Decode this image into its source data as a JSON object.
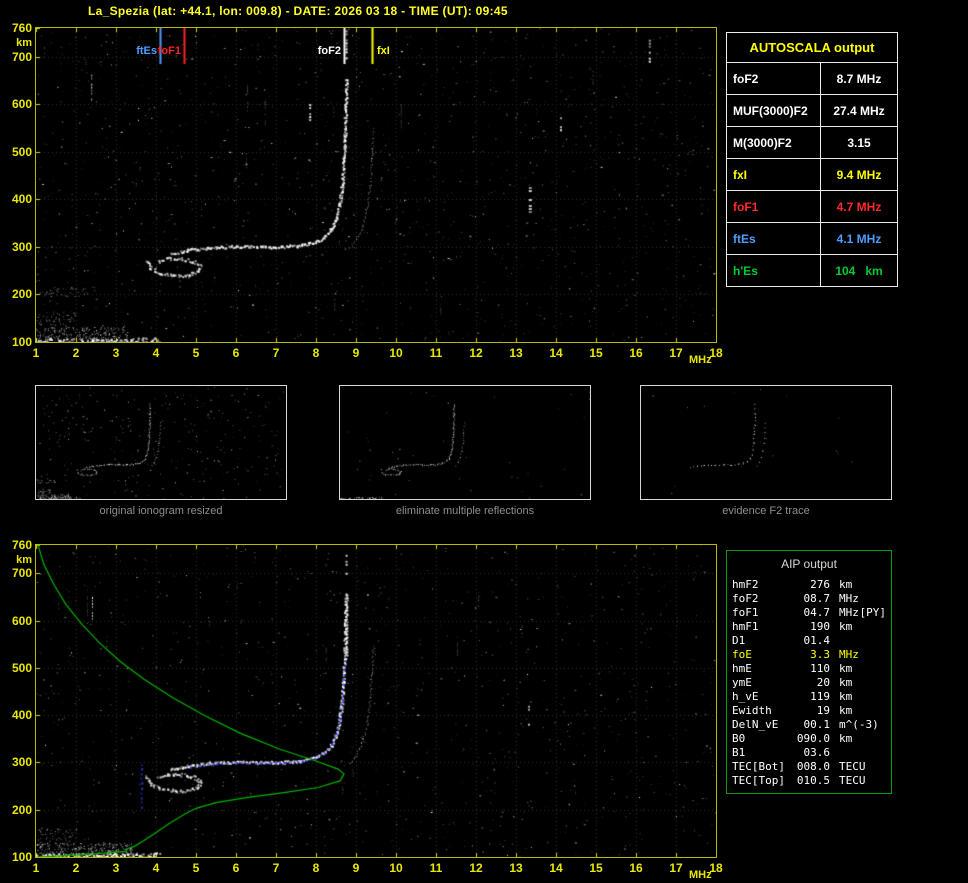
{
  "header": {
    "title": "La_Spezia (lat: +44.1, lon: 009.8) - DATE: 2026 03 18 - TIME (UT): 09:45"
  },
  "autoscala": {
    "title": "AUTOSCALA output",
    "rows": [
      {
        "label": "foF2",
        "value": "8.7 MHz",
        "color": "#ffffff"
      },
      {
        "label": "MUF(3000)F2",
        "value": "27.4 MHz",
        "color": "#ffffff"
      },
      {
        "label": "M(3000)F2",
        "value": "3.15",
        "color": "#ffffff"
      },
      {
        "label": "fxI",
        "value": "9.4 MHz",
        "color": "#ffff00"
      },
      {
        "label": "foF1",
        "value": "4.7 MHz",
        "color": "#ff2a2a"
      },
      {
        "label": "ftEs",
        "value": "4.1 MHz",
        "color": "#4f9dff"
      },
      {
        "label": "h'Es",
        "value": "104   km",
        "color": "#00cc33"
      }
    ]
  },
  "thumbnails": [
    {
      "caption": "original ionogram resized",
      "mode": "full",
      "noise": 300,
      "seed": 101
    },
    {
      "caption": "eliminate multiple reflections",
      "mode": "clean",
      "noise": 40,
      "seed": 102
    },
    {
      "caption": "evidence F2 trace",
      "mode": "f2",
      "noise": 16,
      "seed": 103
    }
  ],
  "aip": {
    "title": "AIP output",
    "rows": [
      {
        "name": "hmF2",
        "value": "276",
        "unit": "km",
        "extra": "",
        "color": "#ffffff"
      },
      {
        "name": "foF2",
        "value": "08.7",
        "unit": "MHz",
        "extra": "",
        "color": "#ffffff"
      },
      {
        "name": "foF1",
        "value": "04.7",
        "unit": "MHz",
        "extra": "[PY]",
        "color": "#ffffff"
      },
      {
        "name": "hmF1",
        "value": "190",
        "unit": "km",
        "extra": "",
        "color": "#ffffff"
      },
      {
        "name": "D1",
        "value": "01.4",
        "unit": "",
        "extra": "",
        "color": "#ffffff"
      },
      {
        "name": "foE",
        "value": "3.3",
        "unit": "MHz",
        "extra": "",
        "color": "#ffff00"
      },
      {
        "name": "hmE",
        "value": "110",
        "unit": "km",
        "extra": "",
        "color": "#ffffff"
      },
      {
        "name": "ymE",
        "value": "20",
        "unit": "km",
        "extra": "",
        "color": "#ffffff"
      },
      {
        "name": "h_vE",
        "value": "119",
        "unit": "km",
        "extra": "",
        "color": "#ffffff"
      },
      {
        "name": "Ewidth",
        "value": "19",
        "unit": "km",
        "extra": "",
        "color": "#ffffff"
      },
      {
        "name": "DelN_vE",
        "value": "00.1",
        "unit": "m^(-3)",
        "extra": "",
        "color": "#ffffff"
      },
      {
        "name": "B0",
        "value": "090.0",
        "unit": "km",
        "extra": "",
        "color": "#ffffff"
      },
      {
        "name": "B1",
        "value": "03.6",
        "unit": "",
        "extra": "",
        "color": "#ffffff"
      },
      {
        "name": "TEC[Bot]",
        "value": "008.0",
        "unit": "TECU",
        "extra": "",
        "color": "#ffffff"
      },
      {
        "name": "TEC[Top]",
        "value": "010.5",
        "unit": "TECU",
        "extra": "",
        "color": "#ffffff"
      }
    ]
  },
  "chart_data": [
    {
      "id": "main_ionogram",
      "type": "scatter",
      "xlabel": "MHz",
      "ylabel": "km",
      "xlim": [
        1,
        18
      ],
      "ylim": [
        100,
        760
      ],
      "x_ticks": [
        1,
        2,
        3,
        4,
        5,
        6,
        7,
        8,
        9,
        10,
        11,
        12,
        13,
        14,
        15,
        16,
        17,
        18
      ],
      "y_ticks": [
        100,
        200,
        300,
        400,
        500,
        600,
        700,
        760
      ],
      "grid": true,
      "markers": [
        {
          "label": "ftEs",
          "freq": 4.1,
          "color": "#4f9dff",
          "side": "left"
        },
        {
          "label": "foF1",
          "freq": 4.7,
          "color": "#ff2222",
          "side": "left"
        },
        {
          "label": "foF2",
          "freq": 8.7,
          "color": "#ffffff",
          "side": "left"
        },
        {
          "label": "fxI",
          "freq": 9.4,
          "color": "#ffff00",
          "side": "right"
        }
      ],
      "noise": {
        "count": 1500,
        "seed": 7,
        "streaks": 16
      },
      "clusters": [
        {
          "f": [
            1.0,
            3.3
          ],
          "km": [
            100,
            132
          ],
          "count": 240,
          "color": "#d8d8d8",
          "size": 1
        },
        {
          "f": [
            1.0,
            2.0
          ],
          "km": [
            132,
            165
          ],
          "count": 60,
          "color": "#9a9a9a",
          "size": 1
        },
        {
          "f": [
            1.0,
            2.3
          ],
          "km": [
            196,
            216
          ],
          "count": 45,
          "color": "#9a9a9a",
          "size": 1
        }
      ],
      "traces": [
        {
          "name": "Es",
          "color": "#ffffff",
          "size": 2,
          "step": 1.1,
          "spread": 5,
          "alpha": 0.9,
          "points": [
            [
              1.0,
              102
            ],
            [
              1.6,
              103
            ],
            [
              2.2,
              104
            ],
            [
              2.9,
              104
            ],
            [
              3.5,
              105
            ],
            [
              4.05,
              105
            ]
          ]
        },
        {
          "name": "F1-cusp",
          "color": "#ffffff",
          "size": 2,
          "step": 1.5,
          "spread": 3,
          "alpha": 0.85,
          "points": [
            [
              3.75,
              271
            ],
            [
              3.85,
              255
            ],
            [
              4.1,
              246
            ],
            [
              4.45,
              241
            ],
            [
              4.8,
              242
            ],
            [
              5.05,
              249
            ],
            [
              5.1,
              261
            ],
            [
              4.9,
              271
            ],
            [
              4.6,
              276
            ],
            [
              4.3,
              277
            ],
            [
              4.05,
              271
            ]
          ]
        },
        {
          "name": "F2-O",
          "color": "#ffffff",
          "size": 2,
          "step": 1.2,
          "spread": 2.6,
          "alpha": 0.95,
          "points": [
            [
              4.35,
              286
            ],
            [
              4.8,
              294
            ],
            [
              5.3,
              299
            ],
            [
              6.0,
              302
            ],
            [
              6.6,
              301
            ],
            [
              7.1,
              301
            ],
            [
              7.6,
              304
            ],
            [
              7.95,
              311
            ],
            [
              8.2,
              322
            ],
            [
              8.38,
              338
            ],
            [
              8.5,
              360
            ],
            [
              8.58,
              390
            ],
            [
              8.64,
              430
            ],
            [
              8.68,
              478
            ],
            [
              8.71,
              535
            ],
            [
              8.73,
              600
            ],
            [
              8.74,
              655
            ]
          ]
        },
        {
          "name": "F2-X",
          "color": "#e8e8e8",
          "size": 1,
          "step": 2.1,
          "spread": 2,
          "alpha": 0.7,
          "points": [
            [
              8.85,
              298
            ],
            [
              9.0,
              316
            ],
            [
              9.15,
              344
            ],
            [
              9.27,
              383
            ],
            [
              9.34,
              428
            ],
            [
              9.39,
              488
            ],
            [
              9.42,
              548
            ]
          ]
        }
      ],
      "artifacts": [
        {
          "f": 8.74,
          "km": [
            695,
            755
          ],
          "size": 2
        },
        {
          "f": 13.32,
          "km": [
            370,
            432
          ],
          "size": 3
        },
        {
          "f": 14.1,
          "km": [
            545,
            585
          ],
          "size": 2
        },
        {
          "f": 16.32,
          "km": [
            688,
            748
          ],
          "size": 2
        },
        {
          "f": 2.38,
          "km": [
            608,
            662
          ],
          "size": 1
        },
        {
          "f": 7.83,
          "km": [
            558,
            600
          ],
          "size": 2
        }
      ]
    },
    {
      "id": "profile_ionogram",
      "type": "scatter",
      "xlabel": "MHz",
      "ylabel": "km",
      "xlim": [
        1,
        18
      ],
      "ylim": [
        100,
        760
      ],
      "x_ticks": [
        1,
        2,
        3,
        4,
        5,
        6,
        7,
        8,
        9,
        10,
        11,
        12,
        13,
        14,
        15,
        16,
        17,
        18
      ],
      "y_ticks": [
        100,
        200,
        300,
        400,
        500,
        600,
        700,
        760
      ],
      "grid": true,
      "markers": [],
      "noise": {
        "count": 1150,
        "seed": 13,
        "streaks": 12
      },
      "clusters": [
        {
          "f": [
            1.0,
            3.4
          ],
          "km": [
            100,
            130
          ],
          "count": 260,
          "color": "#e0e0e0",
          "size": 1
        },
        {
          "f": [
            1.0,
            2.0
          ],
          "km": [
            130,
            162
          ],
          "count": 55,
          "color": "#9a9a9a",
          "size": 1
        }
      ],
      "traces": [
        {
          "name": "Es",
          "color": "#ffffff",
          "size": 2,
          "step": 1.0,
          "spread": 5,
          "alpha": 1,
          "points": [
            [
              1.0,
              102
            ],
            [
              1.6,
              103
            ],
            [
              2.2,
              104
            ],
            [
              2.9,
              104
            ],
            [
              3.5,
              105
            ],
            [
              4.05,
              105
            ]
          ]
        },
        {
          "name": "F1-cusp",
          "color": "#ffffff",
          "size": 2,
          "step": 1.5,
          "spread": 3,
          "alpha": 0.85,
          "points": [
            [
              3.75,
              271
            ],
            [
              3.85,
              255
            ],
            [
              4.1,
              246
            ],
            [
              4.45,
              241
            ],
            [
              4.8,
              242
            ],
            [
              5.05,
              249
            ],
            [
              5.1,
              261
            ],
            [
              4.9,
              271
            ],
            [
              4.6,
              276
            ],
            [
              4.3,
              277
            ],
            [
              4.05,
              271
            ]
          ]
        },
        {
          "name": "F2-O",
          "color": "#ffffff",
          "size": 2,
          "step": 1.2,
          "spread": 2.6,
          "alpha": 0.95,
          "points": [
            [
              4.35,
              286
            ],
            [
              4.8,
              294
            ],
            [
              5.3,
              299
            ],
            [
              6.0,
              302
            ],
            [
              6.6,
              301
            ],
            [
              7.1,
              301
            ],
            [
              7.6,
              304
            ],
            [
              7.95,
              311
            ],
            [
              8.2,
              322
            ],
            [
              8.38,
              338
            ],
            [
              8.5,
              360
            ],
            [
              8.58,
              390
            ],
            [
              8.64,
              430
            ],
            [
              8.68,
              478
            ],
            [
              8.71,
              535
            ],
            [
              8.73,
              600
            ],
            [
              8.74,
              655
            ]
          ]
        },
        {
          "name": "F2-X",
          "color": "#e8e8e8",
          "size": 1,
          "step": 2.1,
          "spread": 2,
          "alpha": 0.7,
          "points": [
            [
              8.85,
              298
            ],
            [
              9.0,
              316
            ],
            [
              9.15,
              344
            ],
            [
              9.27,
              383
            ],
            [
              9.34,
              428
            ],
            [
              9.39,
              488
            ],
            [
              9.42,
              548
            ]
          ]
        }
      ],
      "profile": {
        "color": "#00b400",
        "points": [
          [
            1.05,
            760
          ],
          [
            1.2,
            718
          ],
          [
            1.45,
            676
          ],
          [
            1.75,
            634
          ],
          [
            2.15,
            592
          ],
          [
            2.6,
            552
          ],
          [
            3.1,
            514
          ],
          [
            3.7,
            476
          ],
          [
            4.4,
            438
          ],
          [
            5.2,
            400
          ],
          [
            6.1,
            362
          ],
          [
            7.1,
            328
          ],
          [
            8.0,
            303
          ],
          [
            8.55,
            286
          ],
          [
            8.7,
            276
          ],
          [
            8.6,
            261
          ],
          [
            8.05,
            247
          ],
          [
            7.2,
            236
          ],
          [
            6.3,
            226
          ],
          [
            5.5,
            215
          ],
          [
            5.0,
            203
          ],
          [
            4.7,
            190
          ],
          [
            4.35,
            172
          ],
          [
            4.0,
            152
          ],
          [
            3.7,
            135
          ],
          [
            3.45,
            122
          ],
          [
            3.3,
            118
          ],
          [
            3.25,
            112
          ],
          [
            2.7,
            108
          ],
          [
            2.1,
            105
          ],
          [
            1.5,
            102
          ],
          [
            1.05,
            100
          ]
        ]
      },
      "restored": [
        {
          "color": "#3a3aff",
          "size": 2,
          "step": 4.5,
          "spread": 1.2,
          "alpha": 1,
          "points": [
            [
              4.85,
              292
            ],
            [
              5.4,
              298
            ],
            [
              6.0,
              301
            ],
            [
              6.6,
              300
            ],
            [
              7.2,
              301
            ],
            [
              7.65,
              304
            ],
            [
              7.95,
              310
            ],
            [
              8.2,
              321
            ],
            [
              8.38,
              339
            ],
            [
              8.5,
              362
            ],
            [
              8.58,
              394
            ],
            [
              8.64,
              434
            ],
            [
              8.68,
              476
            ],
            [
              8.7,
              516
            ]
          ]
        },
        {
          "color": "#3a3aff",
          "size": 2,
          "step": 5,
          "spread": 1,
          "alpha": 1,
          "points": [
            [
              3.62,
              297
            ],
            [
              3.62,
              207
            ]
          ]
        }
      ],
      "artifacts": [
        {
          "f": 8.76,
          "km": [
            528,
            668
          ],
          "size": 2
        },
        {
          "f": 8.74,
          "km": [
            697,
            752
          ],
          "size": 2
        },
        {
          "f": 13.3,
          "km": [
            372,
            420
          ],
          "size": 2
        },
        {
          "f": 2.4,
          "km": [
            602,
            650
          ],
          "size": 1
        }
      ]
    }
  ]
}
